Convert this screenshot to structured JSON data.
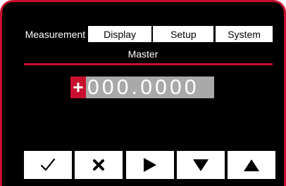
{
  "tabs": [
    {
      "label": "Measurement",
      "active": true
    },
    {
      "label": "Display",
      "active": false
    },
    {
      "label": "Setup",
      "active": false
    },
    {
      "label": "System",
      "active": false
    }
  ],
  "screen": {
    "subtitle": "Master",
    "sign": "+",
    "value": "000.0000"
  },
  "keys": [
    {
      "name": "confirm",
      "icon": "check-icon"
    },
    {
      "name": "cancel",
      "icon": "cross-icon"
    },
    {
      "name": "next",
      "icon": "play-icon"
    },
    {
      "name": "down",
      "icon": "triangle-down-icon"
    },
    {
      "name": "up",
      "icon": "triangle-up-icon"
    }
  ],
  "colors": {
    "accent": "#c8102e",
    "background": "#000000",
    "highlight": "#a9a9a9"
  }
}
